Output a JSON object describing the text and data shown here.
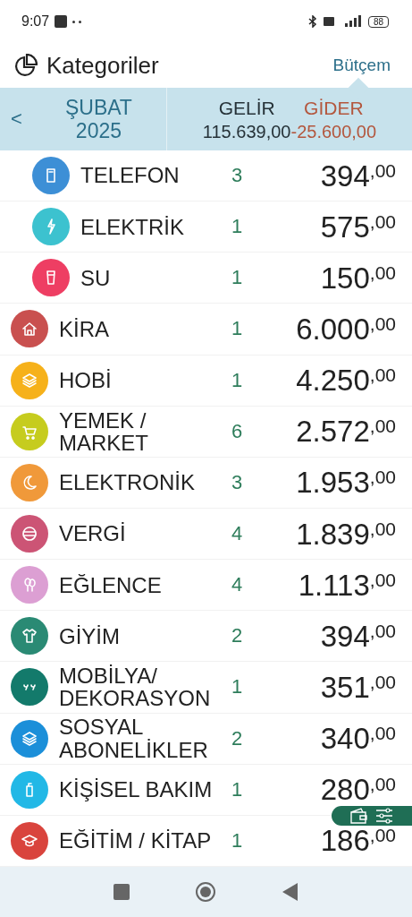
{
  "status_bar": {
    "time": "9:07",
    "battery": "88"
  },
  "header": {
    "title": "Kategoriler",
    "link": "Bütçem"
  },
  "summary": {
    "back": "<",
    "month": "ŞUBAT",
    "year": "2025",
    "income_label": "GELİR",
    "income": "115.639,00",
    "expense_label": "GİDER",
    "expense": "-25.600,00"
  },
  "categories": [
    {
      "kind": "sub",
      "name": "TELEFON",
      "count": "3",
      "amount": "394",
      "decimals": ",00",
      "color": "#3d8fd6"
    },
    {
      "kind": "sub",
      "name": "ELEKTRİK",
      "count": "1",
      "amount": "575",
      "decimals": ",00",
      "color": "#3cc2cf"
    },
    {
      "kind": "sub",
      "name": "SU",
      "count": "1",
      "amount": "150",
      "decimals": ",00",
      "color": "#ee3e63"
    },
    {
      "kind": "main",
      "name": "KİRA",
      "count": "1",
      "amount": "6.000",
      "decimals": ",00",
      "color": "#c9504f"
    },
    {
      "kind": "main",
      "name": "HOBİ",
      "count": "1",
      "amount": "4.250",
      "decimals": ",00",
      "color": "#f6b11a"
    },
    {
      "kind": "main",
      "name": "YEMEK / MARKET",
      "count": "6",
      "amount": "2.572",
      "decimals": ",00",
      "color": "#c6cc1e"
    },
    {
      "kind": "main",
      "name": "ELEKTRONİK",
      "count": "3",
      "amount": "1.953",
      "decimals": ",00",
      "color": "#f0993a"
    },
    {
      "kind": "main",
      "name": "VERGİ",
      "count": "4",
      "amount": "1.839",
      "decimals": ",00",
      "color": "#cc5475"
    },
    {
      "kind": "main",
      "name": "EĞLENCE",
      "count": "4",
      "amount": "1.113",
      "decimals": ",00",
      "color": "#dc9fd3"
    },
    {
      "kind": "main",
      "name": "GİYİM",
      "count": "2",
      "amount": "394",
      "decimals": ",00",
      "color": "#2a8a74"
    },
    {
      "kind": "main",
      "name": "MOBİLYA/ DEKORASYON",
      "count": "1",
      "amount": "351",
      "decimals": ",00",
      "color": "#137a6b"
    },
    {
      "kind": "main",
      "name": "SOSYAL ABONELİKLER",
      "count": "2",
      "amount": "340",
      "decimals": ",00",
      "color": "#1b8fd9"
    },
    {
      "kind": "main",
      "name": "KİŞİSEL BAKIM",
      "count": "1",
      "amount": "280",
      "decimals": ",00",
      "color": "#22b8e6"
    },
    {
      "kind": "main",
      "name": "EĞİTİM / KİTAP",
      "count": "1",
      "amount": "186",
      "decimals": ",00",
      "color": "#d9443d"
    }
  ]
}
